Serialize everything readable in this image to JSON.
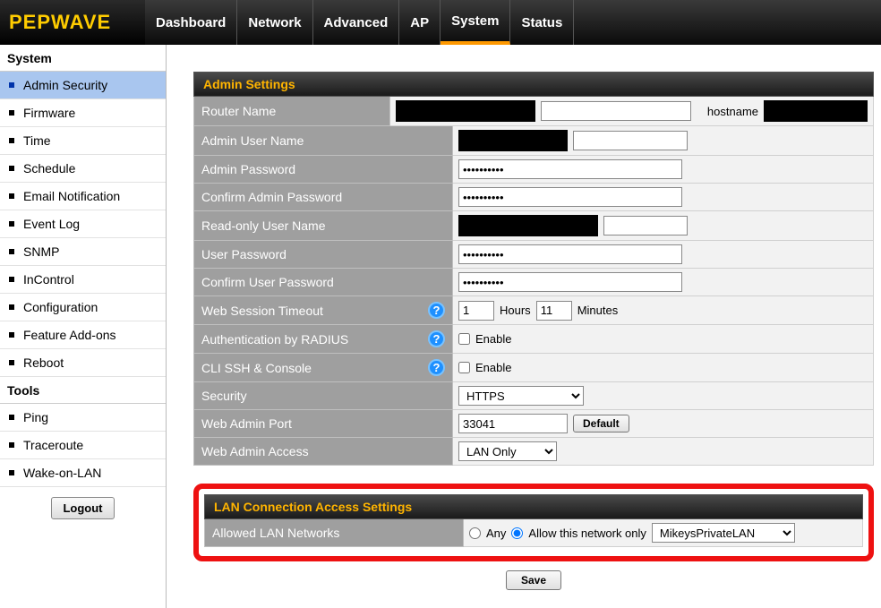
{
  "brand": "PEPWAVE",
  "nav": {
    "items": [
      "Dashboard",
      "Network",
      "Advanced",
      "AP",
      "System",
      "Status"
    ],
    "active": "System"
  },
  "sidebar": {
    "groups": [
      {
        "title": "System",
        "items": [
          "Admin Security",
          "Firmware",
          "Time",
          "Schedule",
          "Email Notification",
          "Event Log",
          "SNMP",
          "InControl",
          "Configuration",
          "Feature Add-ons",
          "Reboot"
        ],
        "active": "Admin Security"
      },
      {
        "title": "Tools",
        "items": [
          "Ping",
          "Traceroute",
          "Wake-on-LAN"
        ]
      }
    ],
    "logout": "Logout"
  },
  "admin_panel": {
    "title": "Admin Settings",
    "rows": {
      "router_name": {
        "label": "Router Name",
        "value": "",
        "hostname_label": "hostname",
        "hostname_value": ""
      },
      "admin_user": {
        "label": "Admin User Name",
        "value": ""
      },
      "admin_pw": {
        "label": "Admin Password",
        "value": "••••••••••"
      },
      "admin_pw2": {
        "label": "Confirm Admin Password",
        "value": "••••••••••"
      },
      "ro_user": {
        "label": "Read-only User Name",
        "value": ""
      },
      "user_pw": {
        "label": "User Password",
        "value": "••••••••••"
      },
      "user_pw2": {
        "label": "Confirm User Password",
        "value": "••••••••••"
      },
      "timeout": {
        "label": "Web Session Timeout",
        "hours": "1",
        "hours_label": "Hours",
        "minutes": "11",
        "minutes_label": "Minutes"
      },
      "radius": {
        "label": "Authentication by RADIUS",
        "enable": "Enable"
      },
      "cli": {
        "label": "CLI SSH & Console",
        "enable": "Enable"
      },
      "security": {
        "label": "Security",
        "value": "HTTPS"
      },
      "port": {
        "label": "Web Admin Port",
        "value": "33041",
        "default_btn": "Default"
      },
      "access": {
        "label": "Web Admin Access",
        "value": "LAN Only"
      }
    }
  },
  "lan_panel": {
    "title": "LAN Connection Access Settings",
    "row": {
      "label": "Allowed LAN Networks",
      "any": "Any",
      "allow": "Allow this network only",
      "network": "MikeysPrivateLAN"
    }
  },
  "save_btn": "Save"
}
